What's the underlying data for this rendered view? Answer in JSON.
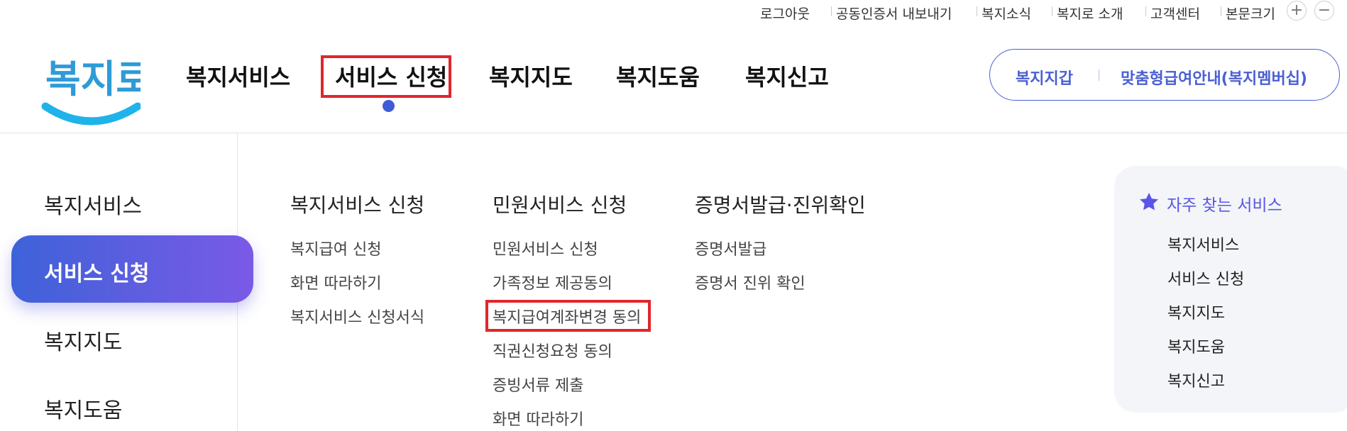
{
  "utility": {
    "logout": "로그아웃",
    "cert_export": "공동인증서 내보내기",
    "news": "복지소식",
    "about": "복지로 소개",
    "support": "고객센터",
    "font_size": "본문크기",
    "zoom_in": "+",
    "zoom_out": "−"
  },
  "logo_text": "복지로",
  "gnb": [
    "복지서비스",
    "서비스 신청",
    "복지지도",
    "복지도움",
    "복지신고"
  ],
  "header_pill": {
    "wallet": "복지지갑",
    "membership": "맞춤형급여안내(복지멤버십)"
  },
  "sidebar": [
    "복지서비스",
    "서비스 신청",
    "복지지도",
    "복지도움"
  ],
  "menu_columns": [
    {
      "title": "복지서비스 신청",
      "links": [
        "복지급여 신청",
        "화면 따라하기",
        "복지서비스 신청서식"
      ]
    },
    {
      "title": "민원서비스 신청",
      "links": [
        "민원서비스 신청",
        "가족정보 제공동의",
        "복지급여계좌변경 동의",
        "직권신청요청 동의",
        "증빙서류 제출",
        "화면 따라하기"
      ]
    },
    {
      "title": "증명서발급·진위확인",
      "links": [
        "증명서발급",
        "증명서 진위 확인"
      ]
    }
  ],
  "favorites": {
    "title": "자주 찾는 서비스",
    "items": [
      "복지서비스",
      "서비스 신청",
      "복지지도",
      "복지도움",
      "복지신고"
    ]
  },
  "colors": {
    "accent": "#4a5fd4",
    "highlight": "#e0262b",
    "active_start": "#3e62d9",
    "active_end": "#7a5ae6"
  }
}
